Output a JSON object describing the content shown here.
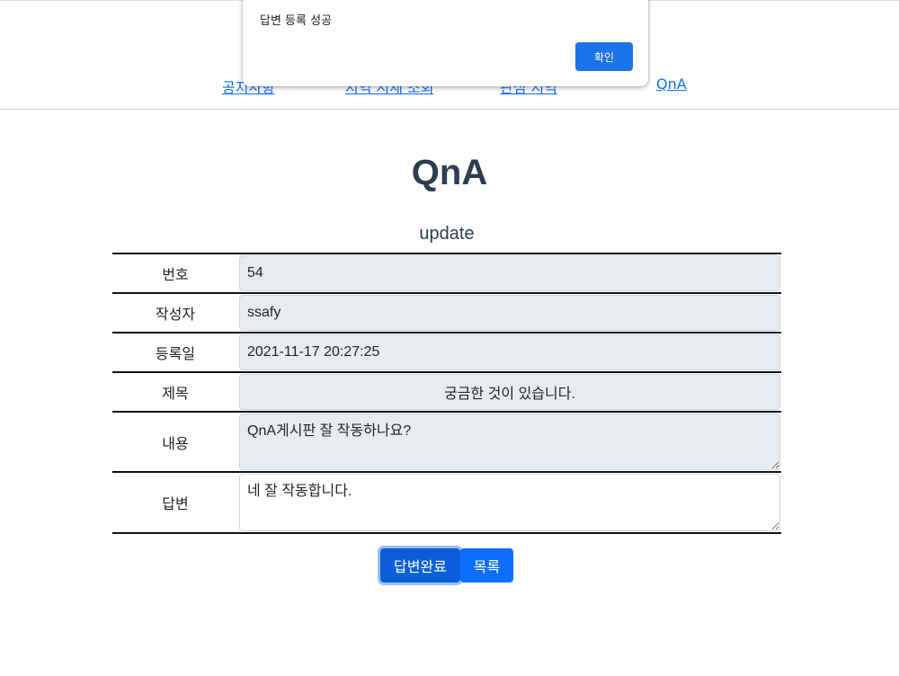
{
  "nav": {
    "items": [
      {
        "label": "공지사항"
      },
      {
        "label": "지역 시세 조회"
      },
      {
        "label": "관심 지역"
      },
      {
        "label": "QnA"
      }
    ]
  },
  "dialog": {
    "message": "답변 등록 성공",
    "ok_label": "확인"
  },
  "page": {
    "title": "QnA",
    "subtitle": "update"
  },
  "form": {
    "no_label": "번호",
    "no_value": "54",
    "author_label": "작성자",
    "author_value": "ssafy",
    "date_label": "등록일",
    "date_value": "2021-11-17 20:27:25",
    "subject_label": "제목",
    "subject_value": "궁금한 것이 있습니다.",
    "content_label": "내용",
    "content_value": "QnA게시판 잘 작동하나요?",
    "answer_label": "답변",
    "answer_value": "네 잘 작동합니다."
  },
  "buttons": {
    "complete_label": "답변완료",
    "list_label": "목록"
  },
  "colors": {
    "primary": "#0d6efd",
    "dialog_button": "#1a73e8",
    "title": "#2c3e50",
    "readonly_bg": "#e9ecef"
  }
}
